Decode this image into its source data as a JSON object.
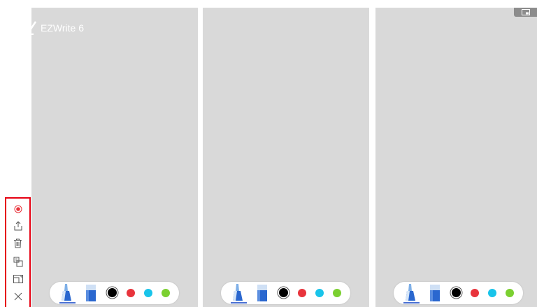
{
  "app": {
    "name": "EZWrite 6"
  },
  "sidebar": {
    "items": [
      {
        "icon": "record-icon",
        "label": ""
      },
      {
        "icon": "share-icon",
        "label": ""
      },
      {
        "icon": "trash-icon",
        "label": ""
      },
      {
        "icon": "copy-icon",
        "label": ""
      },
      {
        "icon": "window-icon",
        "label": ""
      },
      {
        "icon": "close-icon",
        "label": ""
      }
    ]
  },
  "panels": [
    {
      "tools": [
        "pen-icon",
        "eraser-icon"
      ],
      "colors": [
        "#000000",
        "#e8343c",
        "#19c4ea",
        "#7bd030"
      ],
      "selected_color": "#000000"
    },
    {
      "tools": [
        "pen-icon",
        "eraser-icon"
      ],
      "colors": [
        "#000000",
        "#e8343c",
        "#19c4ea",
        "#7bd030"
      ],
      "selected_color": "#000000"
    },
    {
      "tools": [
        "pen-icon",
        "eraser-icon"
      ],
      "colors": [
        "#000000",
        "#e8343c",
        "#19c4ea",
        "#7bd030"
      ],
      "selected_color": "#000000"
    }
  ],
  "colors": {
    "accent": "#4a6fd1",
    "highlight_border": "#e60012",
    "panel_bg": "#d9d9d9"
  }
}
